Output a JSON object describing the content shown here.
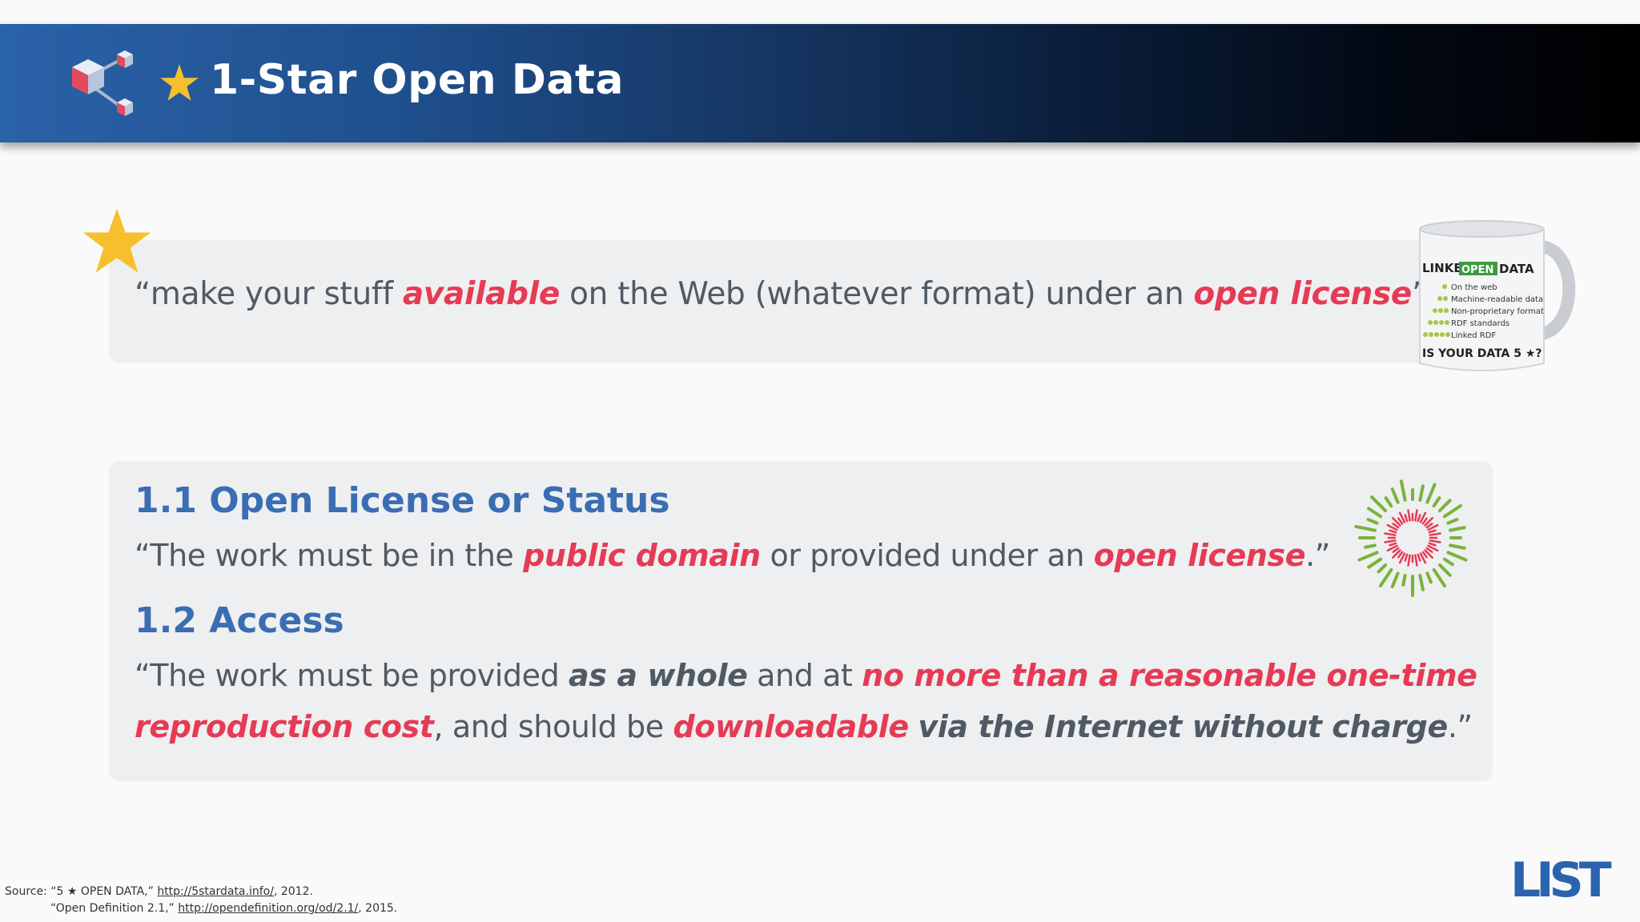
{
  "header": {
    "star_glyph": "★",
    "title": "1-Star Open Data",
    "logo_icon": "linked-cubes-logo-icon"
  },
  "quote": {
    "open_quote": "“make your stuff ",
    "hl1": "available",
    "mid": " on the Web (whatever format) under an ",
    "hl2": "open license",
    "close_quote": "”"
  },
  "mug": {
    "line1_a": "LINKED ",
    "line1_b": "OPEN",
    "line1_c": " DATA",
    "items": [
      "On the web",
      "Machine-readable data",
      "Non-proprietary format",
      "RDF standards",
      "Linked RDF"
    ],
    "bottom": "IS YOUR DATA 5 ★?"
  },
  "section1": {
    "heading": "1.1 Open License or Status",
    "t1": "“The work must be in the ",
    "hl1": "public domain",
    "t2": " or provided under an ",
    "hl2": "open license",
    "t3": ".”"
  },
  "section2": {
    "heading": "1.2 Access",
    "t1": "“The work must be provided ",
    "b1": "as a whole",
    "t2": " and at ",
    "hl1": "no more than a reasonable one-time",
    "hl2": "reproduction cost",
    "t3": ", and should be ",
    "hl3": "downloadable",
    "t4": " ",
    "b2": "via the Internet without charge",
    "t5": ".”"
  },
  "source": {
    "label": "Source: “5 ★ OPEN DATA,” ",
    "link1": "http://5stardata.info/",
    "after1": ", 2012.",
    "line2_pre": "“Open Definition 2.1,” ",
    "link2": "http://opendefinition.org/od/2.1/",
    "after2": ", 2015."
  },
  "logo": {
    "text": "LIST"
  },
  "colors": {
    "accent_red": "#e63a55",
    "heading_blue": "#3a6db3",
    "star_gold": "#f6c02c",
    "list_blue": "#2b64ae"
  }
}
